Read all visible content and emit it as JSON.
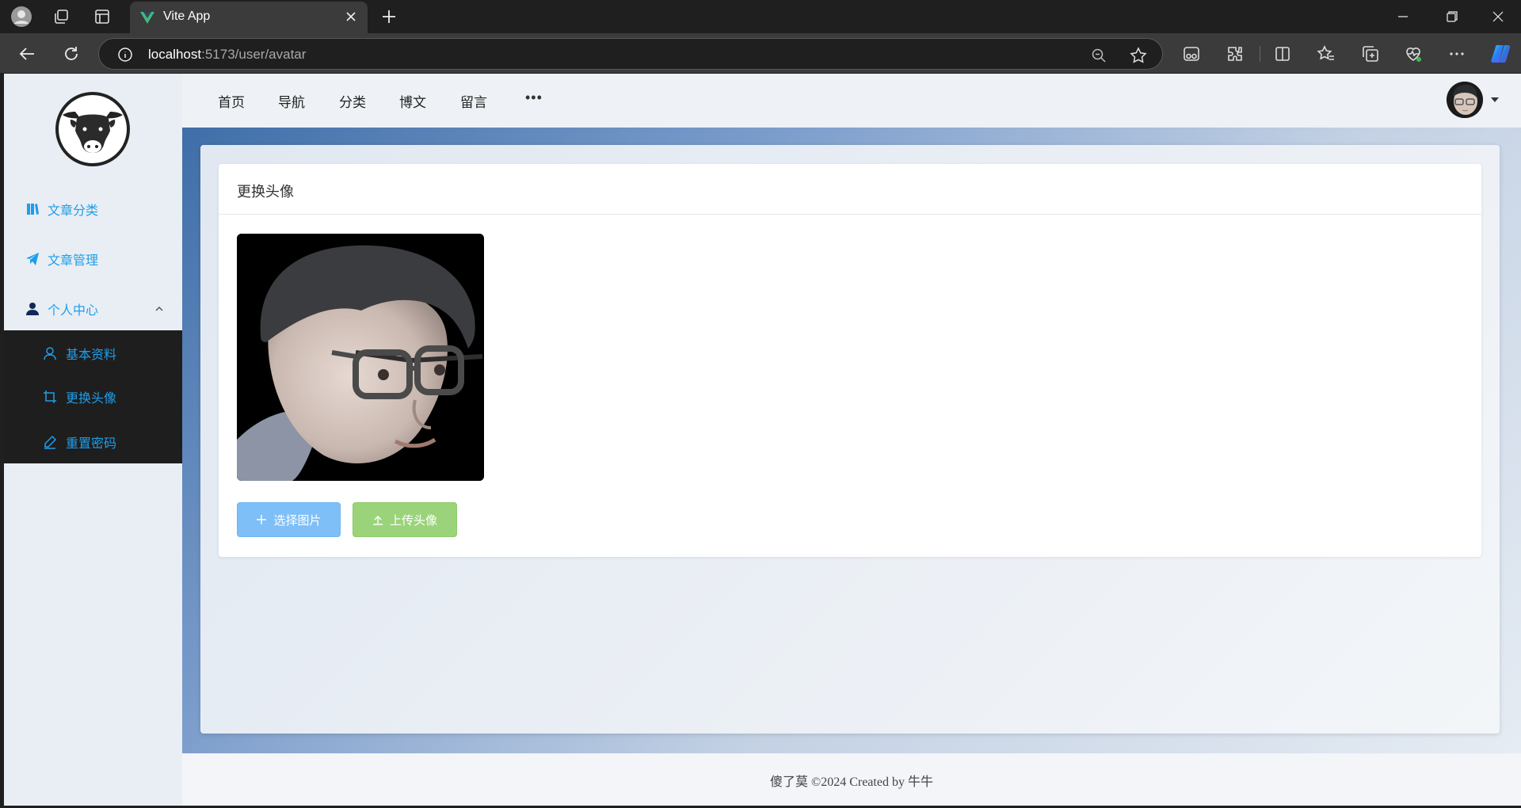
{
  "browser": {
    "tab_title": "Vite App",
    "url_host": "localhost",
    "url_path": ":5173/user/avatar"
  },
  "sidebar": {
    "items": [
      {
        "label": "文章分类",
        "icon": "book-icon"
      },
      {
        "label": "文章管理",
        "icon": "paper-plane-icon"
      },
      {
        "label": "个人中心",
        "icon": "user-icon"
      }
    ],
    "submenu": [
      {
        "label": "基本资料",
        "icon": "user-outline-icon"
      },
      {
        "label": "更换头像",
        "icon": "crop-icon"
      },
      {
        "label": "重置密码",
        "icon": "edit-pen-icon"
      }
    ]
  },
  "topnav": {
    "items": [
      "首页",
      "导航",
      "分类",
      "博文",
      "留言"
    ],
    "more": "•••"
  },
  "card": {
    "title": "更换头像"
  },
  "buttons": {
    "choose": "选择图片",
    "upload": "上传头像"
  },
  "footer": {
    "text": "傻了莫 ©2024 Created by 牛牛"
  },
  "colors": {
    "accent": "#1e9eea",
    "primary_button": "#7fbff7",
    "success_button": "#9bd37a"
  }
}
